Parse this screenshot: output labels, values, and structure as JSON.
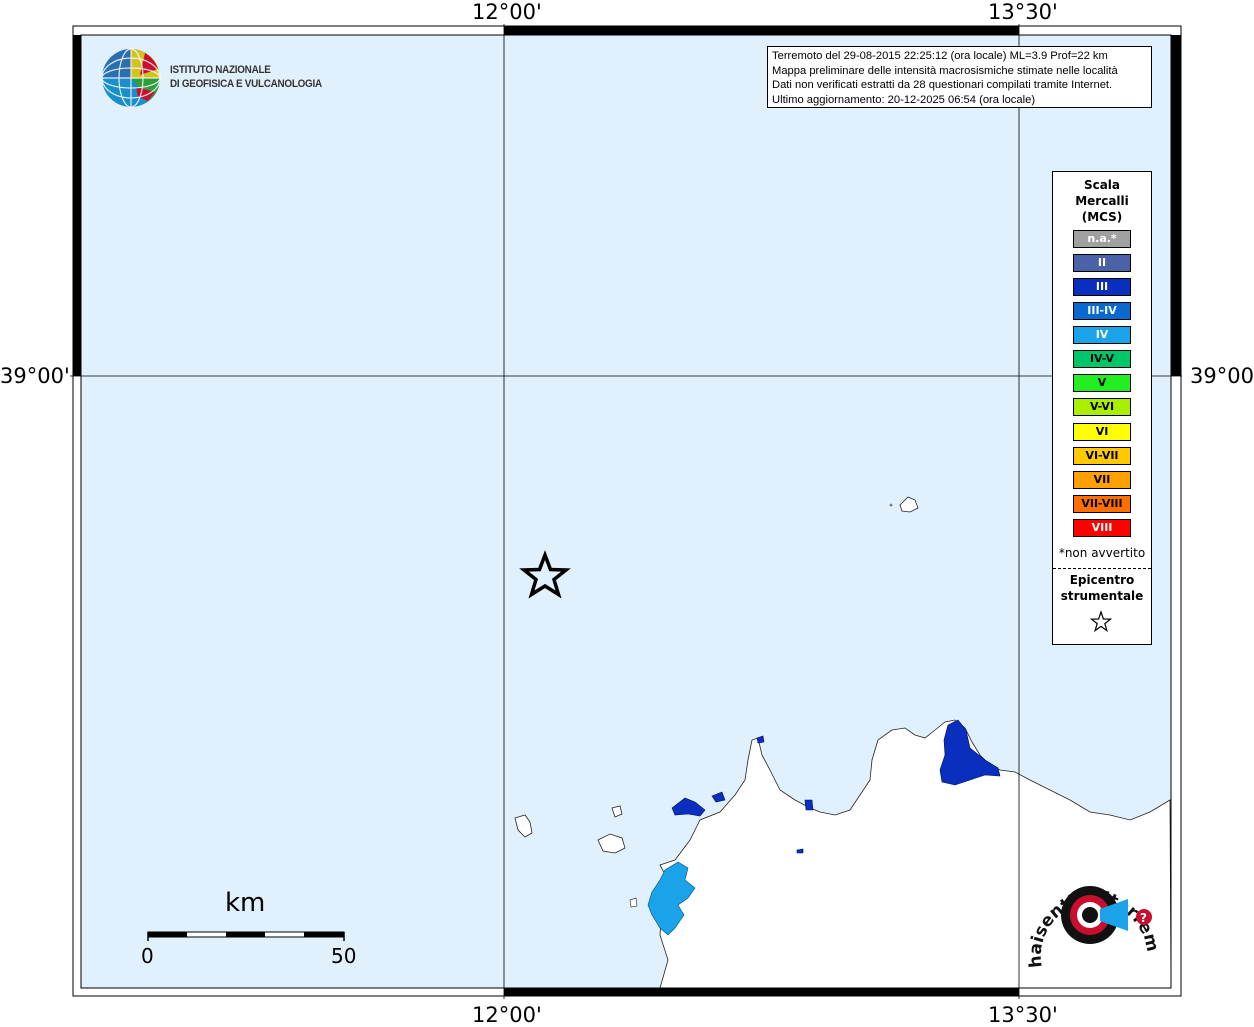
{
  "axes": {
    "top_left_lon": "12°00'",
    "top_right_lon": "13°30'",
    "bottom_left_lon": "12°00'",
    "bottom_right_lon": "13°30'",
    "left_lat": "39°00'",
    "right_lat": "39°00'"
  },
  "logo_ingv": {
    "line1": "ISTITUTO NAZIONALE",
    "line2": "DI GEOFISICA E VULCANOLOGIA"
  },
  "info": {
    "line1": "Terremoto del 29-08-2015 22:25:12 (ora locale) ML=3.9 Prof=22 km",
    "line2": "Mappa preliminare delle intensità macrosismiche stimate nelle località",
    "line3": "Dati non verificati estratti da 28 questionari compilati tramite Internet.",
    "line4": "Ultimo aggiornamento: 20-12-2025 06:54 (ora locale)"
  },
  "legend": {
    "title_line1": "Scala",
    "title_line2": "Mercalli",
    "title_line3": "(MCS)",
    "items": [
      {
        "label": "n.a.*",
        "color": "#a0a0a0"
      },
      {
        "label": "II",
        "color": "#4a62a8"
      },
      {
        "label": "III",
        "color": "#0a2fbe"
      },
      {
        "label": "III-IV",
        "color": "#0a69cf"
      },
      {
        "label": "IV",
        "color": "#1aa3e8"
      },
      {
        "label": "IV-V",
        "color": "#00c66a"
      },
      {
        "label": "V",
        "color": "#22ee22"
      },
      {
        "label": "V-VI",
        "color": "#aaee00"
      },
      {
        "label": "VI",
        "color": "#ffff00"
      },
      {
        "label": "VI-VII",
        "color": "#ffc800"
      },
      {
        "label": "VII",
        "color": "#ffa000"
      },
      {
        "label": "VII-VIII",
        "color": "#ff6f00"
      },
      {
        "label": "VIII",
        "color": "#ff0000"
      }
    ],
    "note": "*non avvertito",
    "epicenter_line1": "Epicentro",
    "epicenter_line2": "strumentale"
  },
  "scale": {
    "unit": "km",
    "min": "0",
    "max": "50"
  },
  "logo_hst": {
    "text": "haisentitoilterremoto.it"
  },
  "colors": {
    "sea": "#e0f0fd",
    "land": "#ffffff",
    "intensity_III": "#0a2fbe",
    "intensity_IV": "#1aa3e8"
  }
}
